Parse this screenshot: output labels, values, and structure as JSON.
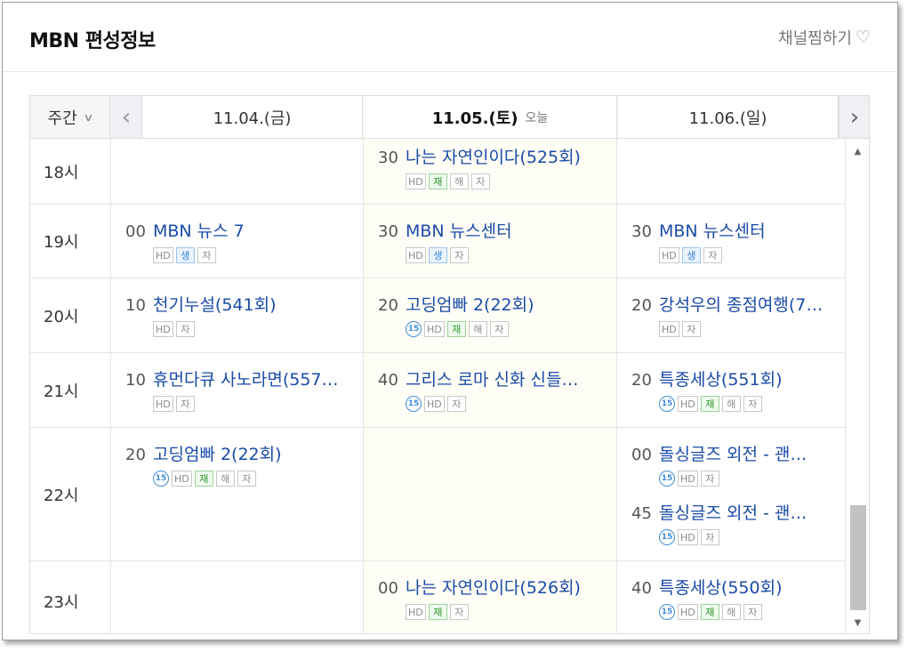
{
  "header": {
    "title": "MBN 편성정보",
    "favorite_label": "채널찜하기"
  },
  "nav": {
    "week_label": "주간",
    "days": [
      {
        "label": "11.04.(금)",
        "today": false
      },
      {
        "label": "11.05.(토)",
        "today": true,
        "today_tag": "오늘"
      },
      {
        "label": "11.06.(일)",
        "today": false
      }
    ]
  },
  "schedule": {
    "hours": [
      "18시",
      "19시",
      "20시",
      "21시",
      "22시",
      "23시"
    ],
    "programs": {
      "h18_d2": {
        "min": "30",
        "name": "나는 자연인이다(525회)",
        "tags": [
          "HD",
          "재",
          "해",
          "자"
        ]
      },
      "h19_d1": {
        "min": "00",
        "name": "MBN 뉴스 7",
        "tags": [
          "HD",
          "생",
          "자"
        ]
      },
      "h19_d2": {
        "min": "30",
        "name": "MBN 뉴스센터",
        "tags": [
          "HD",
          "생",
          "자"
        ]
      },
      "h19_d3": {
        "min": "30",
        "name": "MBN 뉴스센터",
        "tags": [
          "HD",
          "생",
          "자"
        ]
      },
      "h20_d1": {
        "min": "10",
        "name": "천기누설(541회)",
        "tags": [
          "HD",
          "자"
        ]
      },
      "h20_d2": {
        "min": "20",
        "name": "고딩엄빠 2(22회)",
        "tags": [
          "15",
          "HD",
          "재",
          "해",
          "자"
        ]
      },
      "h20_d3": {
        "min": "20",
        "name": "강석우의 종점여행(7…",
        "tags": [
          "HD",
          "자"
        ]
      },
      "h21_d1": {
        "min": "10",
        "name": "휴먼다큐 사노라면(557…",
        "tags": [
          "HD",
          "자"
        ]
      },
      "h21_d2": {
        "min": "40",
        "name": "그리스 로마 신화 신들…",
        "tags": [
          "15",
          "HD",
          "자"
        ]
      },
      "h21_d3": {
        "min": "20",
        "name": "특종세상(551회)",
        "tags": [
          "15",
          "HD",
          "재",
          "해",
          "자"
        ]
      },
      "h22_d1": {
        "min": "20",
        "name": "고딩엄빠 2(22회)",
        "tags": [
          "15",
          "HD",
          "재",
          "해",
          "자"
        ]
      },
      "h22_d3a": {
        "min": "00",
        "name": "돌싱글즈 외전 - 괜…",
        "tags": [
          "15",
          "HD",
          "자"
        ]
      },
      "h22_d3b": {
        "min": "45",
        "name": "돌싱글즈 외전 - 괜…",
        "tags": [
          "15",
          "HD",
          "자"
        ]
      },
      "h23_d2": {
        "min": "00",
        "name": "나는 자연인이다(526회)",
        "tags": [
          "HD",
          "재",
          "자"
        ]
      },
      "h23_d3": {
        "min": "40",
        "name": "특종세상(550회)",
        "tags": [
          "15",
          "HD",
          "재",
          "해",
          "자"
        ]
      }
    }
  },
  "icons": {
    "favorite": "heart-icon",
    "prev": "chevron-left-icon",
    "next": "chevron-right-icon",
    "week_dropdown": "chevron-down-icon"
  },
  "colors": {
    "program_link": "#1a4ba8",
    "live_tag": "#2b7fd6",
    "rerun_tag": "#2a9a2a",
    "age_badge": "#3f8ed8",
    "today_column": "#fffef6"
  }
}
